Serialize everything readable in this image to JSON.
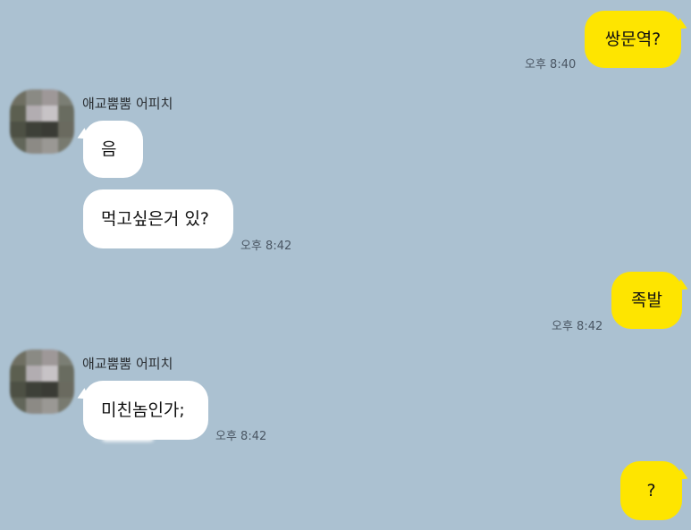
{
  "colors": {
    "background": "#abc1d1",
    "my_bubble": "#fee500",
    "other_bubble": "#ffffff",
    "time_text": "#4a5663"
  },
  "messages": [
    {
      "from": "me",
      "text": "쌍문역?",
      "time": "오후 8:40"
    },
    {
      "from": "other",
      "sender": "애교뿜뿜 어피치",
      "text": "음",
      "time": ""
    },
    {
      "from": "other",
      "text": "먹고싶은거 있?",
      "time": "오후 8:42"
    },
    {
      "from": "me",
      "text": "족발",
      "time": "오후 8:42"
    },
    {
      "from": "other",
      "sender": "애교뿜뿜 어피치",
      "text": "미친놈인가;",
      "time": "오후 8:42"
    },
    {
      "from": "me",
      "text": "?",
      "time": ""
    }
  ],
  "avatar_icon": "blurred-profile-photo"
}
